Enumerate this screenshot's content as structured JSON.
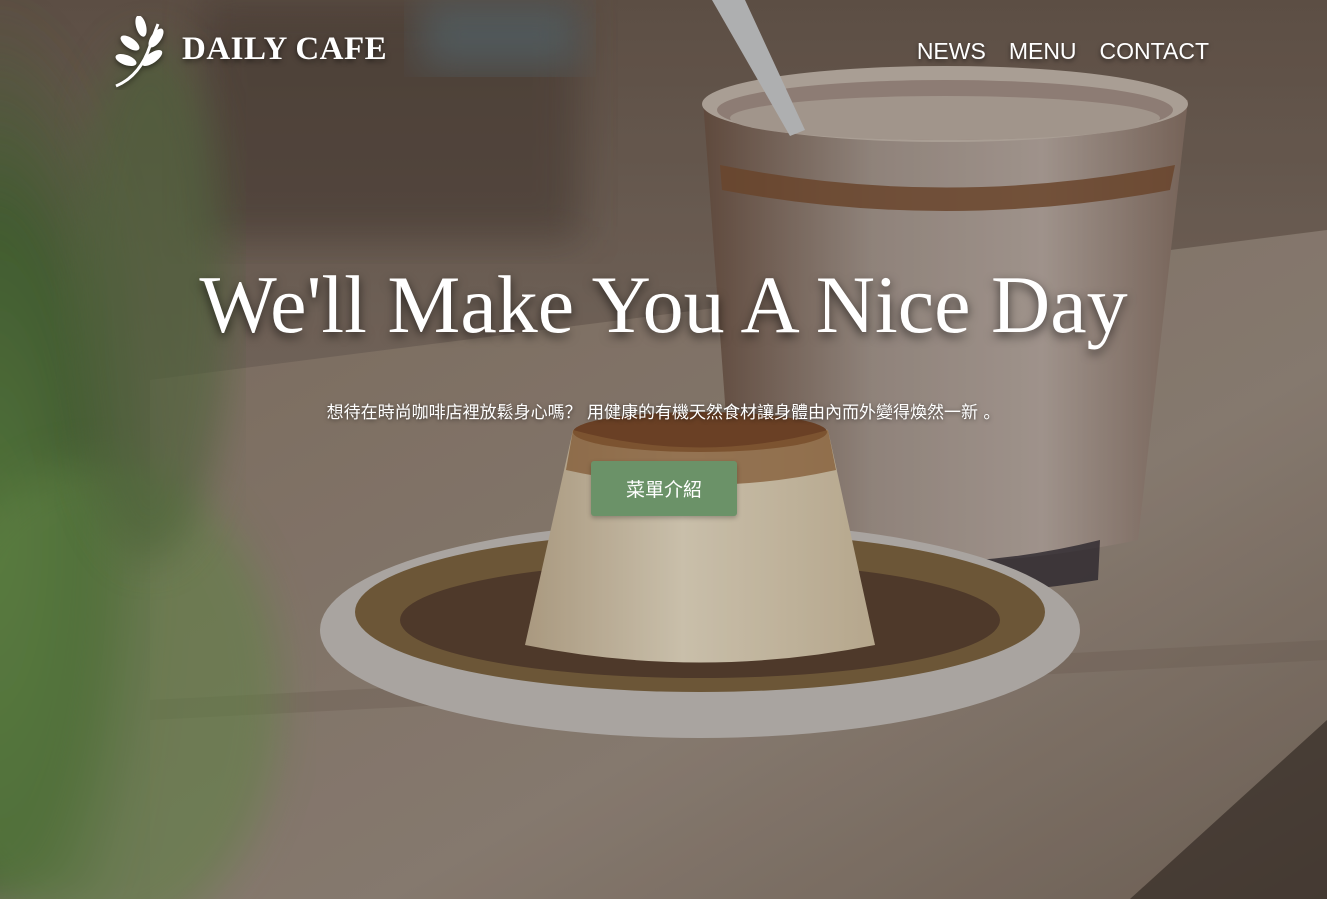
{
  "brand": {
    "name": "DAILY CAFE",
    "logo_icon": "leaf-icon"
  },
  "nav": {
    "items": [
      {
        "label": "NEWS"
      },
      {
        "label": "MENU"
      },
      {
        "label": "CONTACT"
      }
    ]
  },
  "hero": {
    "headline": "We'll Make You A Nice Day",
    "subtitle": "想待在時尚咖啡店裡放鬆身心嗎？ 用健康的有機天然食材讓身體由內而外變得煥然一新 。",
    "cta_label": "菜單介紹",
    "background_image": "coffee-and-pudding-photo"
  },
  "colors": {
    "accent": "#6b9268",
    "text": "#ffffff"
  }
}
